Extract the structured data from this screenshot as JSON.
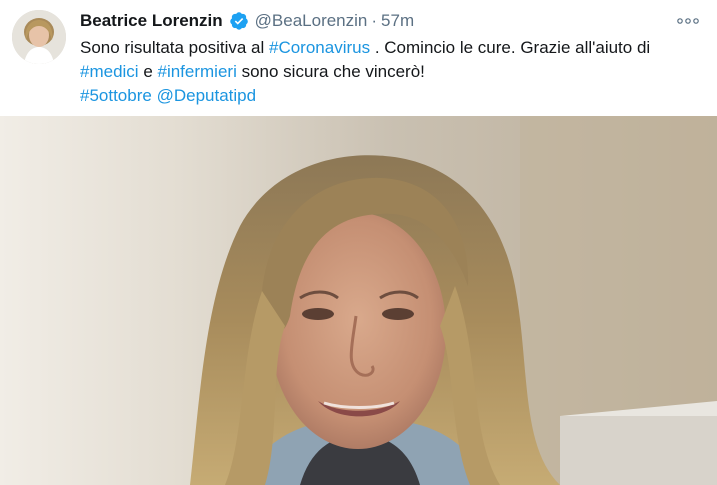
{
  "tweet": {
    "name": "Beatrice Lorenzin",
    "handle": "@BeaLorenzin",
    "separator": "·",
    "time": "57m",
    "lines": [
      [
        {
          "t": "Sono risultata positiva al ",
          "kind": "text"
        },
        {
          "t": "#Coronavirus",
          "kind": "tag"
        },
        {
          "t": " . Comincio le cure. Grazie all'aiuto di",
          "kind": "text"
        }
      ],
      [
        {
          "t": "#medici",
          "kind": "tag"
        },
        {
          "t": " e ",
          "kind": "text"
        },
        {
          "t": "#infermieri",
          "kind": "tag"
        },
        {
          "t": " sono sicura che vincerò!",
          "kind": "text"
        }
      ],
      [
        {
          "t": "#5ottobre",
          "kind": "tag"
        },
        {
          "t": " ",
          "kind": "text"
        },
        {
          "t": "@Deputatipd",
          "kind": "tag"
        }
      ]
    ]
  },
  "icons": {
    "verified": "verified-badge-icon",
    "more": "more-options-icon"
  },
  "colors": {
    "link": "#1b95e0",
    "verified": "#1da1f2",
    "muted": "#5b7083",
    "text": "#14171a"
  }
}
